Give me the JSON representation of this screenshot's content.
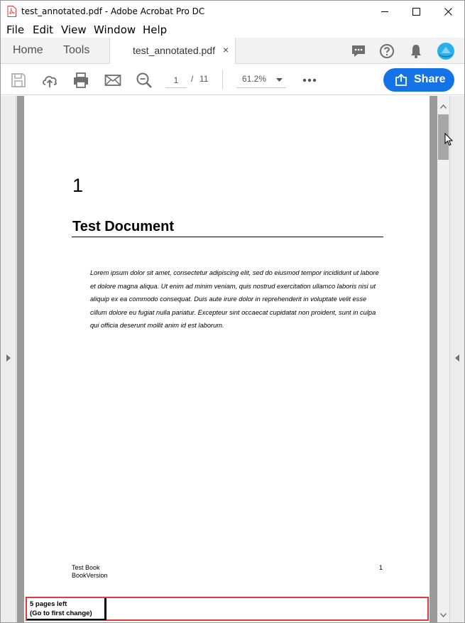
{
  "window": {
    "title": "test_annotated.pdf - Adobe Acrobat Pro DC"
  },
  "menu": [
    "File",
    "Edit",
    "View",
    "Window",
    "Help"
  ],
  "tabs": {
    "home": "Home",
    "tools": "Tools",
    "document": "test_annotated.pdf",
    "close_glyph": "×"
  },
  "toolbar": {
    "current_page": "1",
    "page_separator": "/",
    "total_pages": "11",
    "zoom": "61.2%",
    "share_label": "Share"
  },
  "document": {
    "chapter_number": "1",
    "title": "Test Document",
    "body": "Lorem ipsum dolor sit amet, consectetur adipiscing elit, sed do eiusmod tempor incididunt ut labore et dolore magna aliqua. Ut enim ad minim veniam, quis nostrud exercitation ullamco laboris nisi ut aliquip ex ea commodo consequat. Duis aute irure dolor in reprehenderit in voluptate velit esse cillum dolore eu fugiat nulla pariatur. Excepteur sint occaecat cupidatat non proident, sunt in culpa qui officia deserunt mollit anim id est laborum.",
    "footer_left_1": "Test Book",
    "footer_left_2": "BookVersion",
    "footer_right": "1"
  },
  "annotation": {
    "line1": "5 pages left",
    "line2": "(Go to first change)"
  },
  "colors": {
    "accent": "#1473e6",
    "annotation_border": "#e0393e",
    "pdf_icon": "#e0393e"
  },
  "icons": [
    "pdf-file-icon",
    "minimize-icon",
    "maximize-icon",
    "close-icon",
    "comment-icon",
    "help-icon",
    "bell-icon",
    "user-avatar-icon",
    "save-icon",
    "cloud-upload-icon",
    "print-icon",
    "email-icon",
    "zoom-search-icon",
    "dropdown-caret-icon",
    "more-icon",
    "share-icon",
    "mouse-cursor-icon"
  ]
}
